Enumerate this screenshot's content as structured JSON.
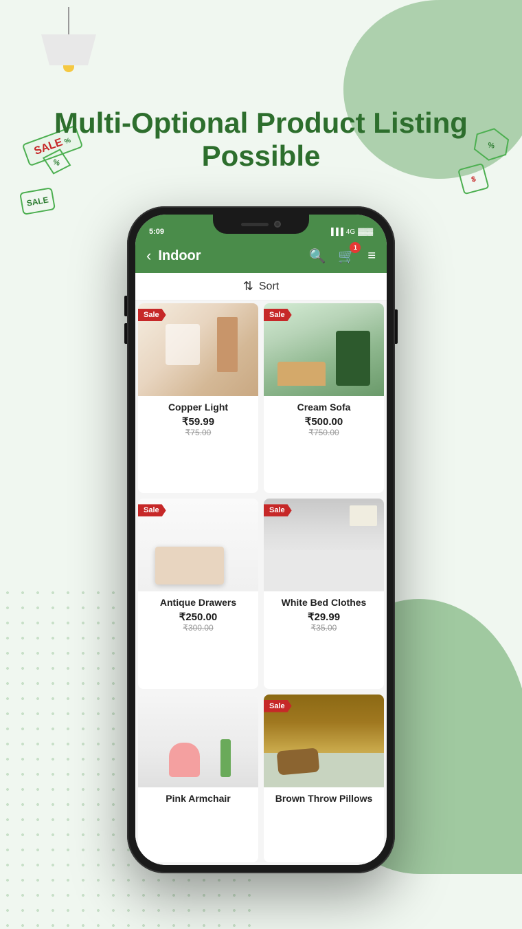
{
  "page": {
    "title": "Multi-Optional Product Listing Possible",
    "background_color": "#eef7ee"
  },
  "status_bar": {
    "time": "5:09",
    "signal": "◀▶",
    "network": "4G",
    "battery": "▓▓"
  },
  "nav": {
    "back_label": "‹",
    "title": "Indoor",
    "cart_badge": "1"
  },
  "sort": {
    "label": "Sort"
  },
  "products": [
    {
      "id": "copper-light",
      "name": "Copper Light",
      "price": "₹59.99",
      "original_price": "₹75.00",
      "has_sale": true,
      "sale_label": "Sale"
    },
    {
      "id": "cream-sofa",
      "name": "Cream Sofa",
      "price": "₹500.00",
      "original_price": "₹750.00",
      "has_sale": true,
      "sale_label": "Sale"
    },
    {
      "id": "antique-drawers",
      "name": "Antique Drawers",
      "price": "₹250.00",
      "original_price": "₹300.00",
      "has_sale": true,
      "sale_label": "Sale"
    },
    {
      "id": "white-bed-clothes",
      "name": "White Bed Clothes",
      "price": "₹29.99",
      "original_price": "₹35.00",
      "has_sale": true,
      "sale_label": "Sale"
    },
    {
      "id": "pink-armchair",
      "name": "Pink Armchair",
      "price": "",
      "original_price": "",
      "has_sale": false,
      "sale_label": ""
    },
    {
      "id": "brown-throw-pillows",
      "name": "Brown Throw Pillows",
      "price": "",
      "original_price": "",
      "has_sale": true,
      "sale_label": "Sale"
    }
  ]
}
